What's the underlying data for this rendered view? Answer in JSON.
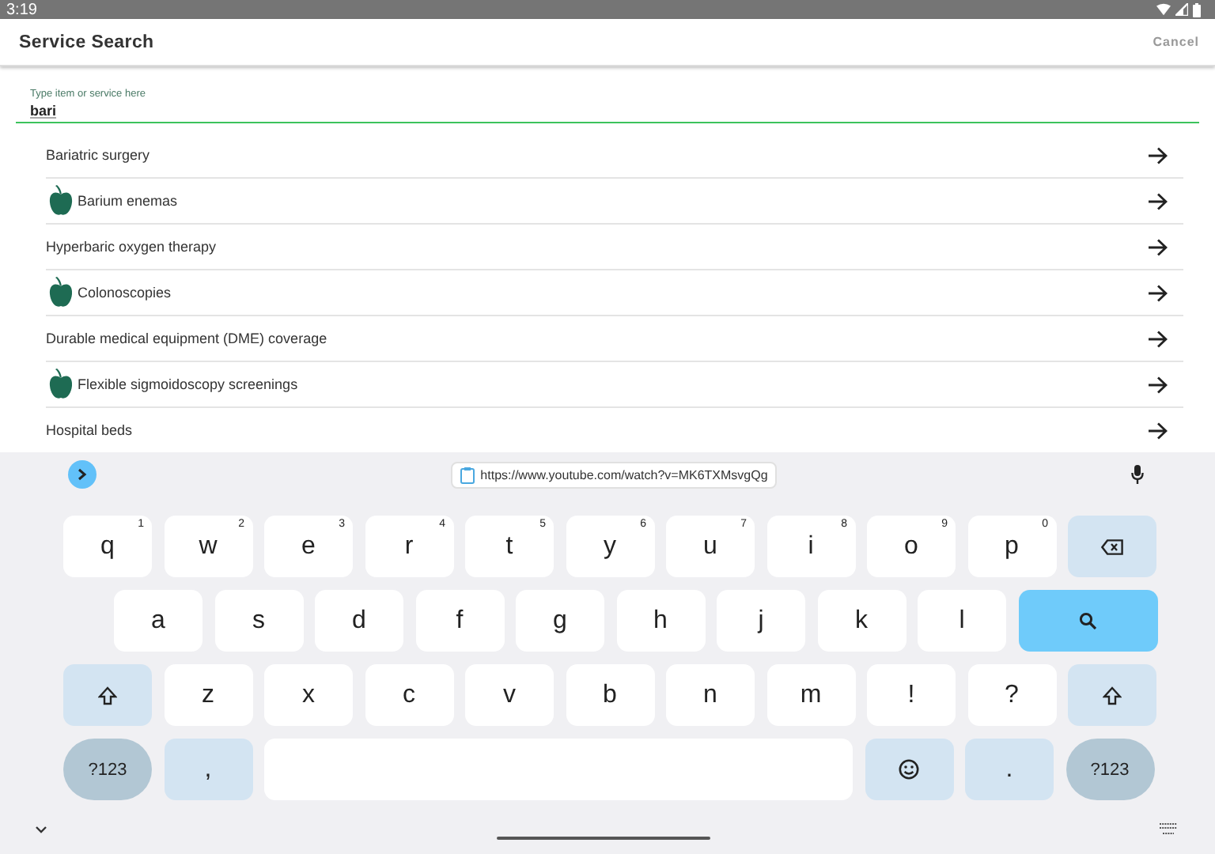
{
  "status_bar": {
    "time": "3:19"
  },
  "header": {
    "title": "Service Search",
    "cancel": "Cancel"
  },
  "search": {
    "label": "Type item or service here",
    "value": "bari"
  },
  "results": [
    {
      "label": "Bariatric surgery",
      "marked": false
    },
    {
      "label": "Barium enemas",
      "marked": true
    },
    {
      "label": "Hyperbaric oxygen therapy",
      "marked": false
    },
    {
      "label": "Colonoscopies",
      "marked": true
    },
    {
      "label": "Durable medical equipment (DME) coverage",
      "marked": false
    },
    {
      "label": "Flexible sigmoidoscopy screenings",
      "marked": true
    },
    {
      "label": "Hospital beds",
      "marked": false
    }
  ],
  "keyboard": {
    "clipboard": "https://www.youtube.com/watch?v=MK6TXMsvgQg",
    "rows": [
      {
        "keys": [
          {
            "kind": "letter",
            "label": "q",
            "hint": "1"
          },
          {
            "kind": "letter",
            "label": "w",
            "hint": "2"
          },
          {
            "kind": "letter",
            "label": "e",
            "hint": "3"
          },
          {
            "kind": "letter",
            "label": "r",
            "hint": "4"
          },
          {
            "kind": "letter",
            "label": "t",
            "hint": "5"
          },
          {
            "kind": "letter",
            "label": "y",
            "hint": "6"
          },
          {
            "kind": "letter",
            "label": "u",
            "hint": "7"
          },
          {
            "kind": "letter",
            "label": "i",
            "hint": "8"
          },
          {
            "kind": "letter",
            "label": "o",
            "hint": "9"
          },
          {
            "kind": "letter",
            "label": "p",
            "hint": "0"
          },
          {
            "kind": "backspace"
          }
        ]
      },
      {
        "keys": [
          {
            "kind": "letter",
            "label": "a"
          },
          {
            "kind": "letter",
            "label": "s"
          },
          {
            "kind": "letter",
            "label": "d"
          },
          {
            "kind": "letter",
            "label": "f"
          },
          {
            "kind": "letter",
            "label": "g"
          },
          {
            "kind": "letter",
            "label": "h"
          },
          {
            "kind": "letter",
            "label": "j"
          },
          {
            "kind": "letter",
            "label": "k"
          },
          {
            "kind": "letter",
            "label": "l"
          },
          {
            "kind": "search"
          }
        ]
      },
      {
        "keys": [
          {
            "kind": "shift"
          },
          {
            "kind": "letter",
            "label": "z"
          },
          {
            "kind": "letter",
            "label": "x"
          },
          {
            "kind": "letter",
            "label": "c"
          },
          {
            "kind": "letter",
            "label": "v"
          },
          {
            "kind": "letter",
            "label": "b"
          },
          {
            "kind": "letter",
            "label": "n"
          },
          {
            "kind": "letter",
            "label": "m"
          },
          {
            "kind": "letter",
            "label": "!"
          },
          {
            "kind": "letter",
            "label": "?"
          },
          {
            "kind": "shift"
          }
        ]
      },
      {
        "keys": [
          {
            "kind": "symbols",
            "label": "?123"
          },
          {
            "kind": "function",
            "label": ","
          },
          {
            "kind": "space"
          },
          {
            "kind": "emoji"
          },
          {
            "kind": "function",
            "label": "."
          },
          {
            "kind": "symbols",
            "label": "?123"
          }
        ]
      }
    ]
  }
}
